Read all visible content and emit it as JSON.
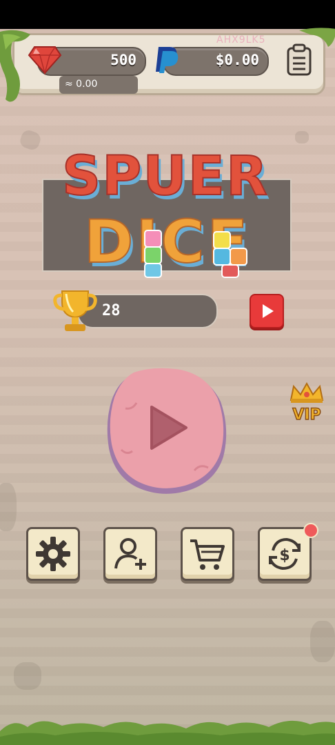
{
  "wallet": {
    "gems": "500",
    "cash": "$0.00",
    "cash_approx": "≈ 0.00",
    "watermark": "AHX9LK5"
  },
  "logo": {
    "line1": "SPUER",
    "line2": "DICE"
  },
  "score": {
    "best": "28"
  },
  "badges": {
    "vip": "VIP"
  },
  "menu": {
    "items": [
      {
        "name": "settings",
        "icon": "gear-icon"
      },
      {
        "name": "invite-friend",
        "icon": "add-user-icon"
      },
      {
        "name": "shop",
        "icon": "cart-icon"
      },
      {
        "name": "cash-exchange",
        "icon": "dollar-cycle-icon"
      }
    ]
  },
  "colors": {
    "accent_red": "#e83a3a",
    "play_pink": "#eba0aa",
    "logo_red": "#e2523c",
    "logo_blue": "#6aaed6",
    "gold": "#f0b429"
  }
}
